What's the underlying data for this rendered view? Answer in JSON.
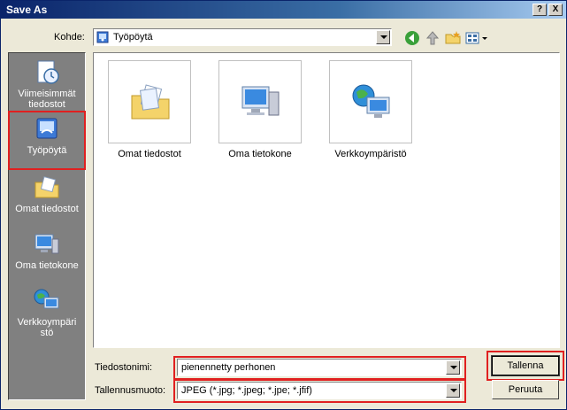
{
  "window": {
    "title": "Save As"
  },
  "titlebar_buttons": {
    "help": "?",
    "close": "X"
  },
  "location": {
    "label": "Kohde:",
    "value": "Työpöytä"
  },
  "places": [
    {
      "label": "Viimeisimmät tiedostot",
      "icon": "recent-documents-icon"
    },
    {
      "label": "Työpöytä",
      "icon": "desktop-icon"
    },
    {
      "label": "Omat tiedostot",
      "icon": "my-documents-icon"
    },
    {
      "label": "Oma tietokone",
      "icon": "my-computer-icon"
    },
    {
      "label": "Verkkoympäristö",
      "icon": "network-icon"
    }
  ],
  "items": [
    {
      "label": "Omat tiedostot",
      "icon": "my-documents-icon"
    },
    {
      "label": "Oma tietokone",
      "icon": "my-computer-icon"
    },
    {
      "label": "Verkkoympäristö",
      "icon": "network-icon"
    }
  ],
  "filename": {
    "label": "Tiedostonimi:",
    "value": "pienennetty perhonen"
  },
  "filetype": {
    "label": "Tallennusmuoto:",
    "value": "JPEG (*.jpg; *.jpeg; *.jpe; *.jfif)"
  },
  "buttons": {
    "save": "Tallenna",
    "cancel": "Peruuta"
  },
  "colors": {
    "title_bar": "#0a246a",
    "highlight_outline": "#e02020",
    "places_bg": "#808080"
  }
}
